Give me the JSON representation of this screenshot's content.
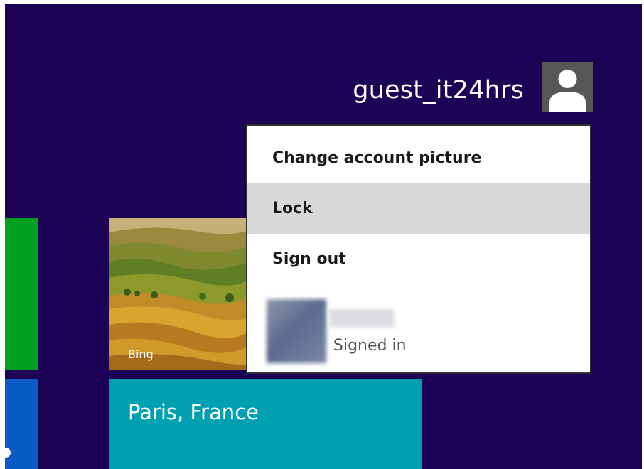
{
  "user": {
    "name": "guest_it24hrs",
    "avatar_icon": "user-silhouette-icon"
  },
  "menu": {
    "items": [
      {
        "label": "Change account picture"
      },
      {
        "label": "Lock",
        "highlighted": true
      },
      {
        "label": "Sign out"
      }
    ],
    "other_user": {
      "status": "Signed in"
    }
  },
  "tiles": {
    "bing": {
      "label": "Bing"
    },
    "weather": {
      "label": "Paris, France"
    }
  },
  "colors": {
    "start_background": "#1c0356",
    "menu_highlight": "#d8d8d8",
    "tile_green": "#00a120",
    "tile_blue": "#0a5bc4",
    "tile_teal": "#00a0b0"
  }
}
